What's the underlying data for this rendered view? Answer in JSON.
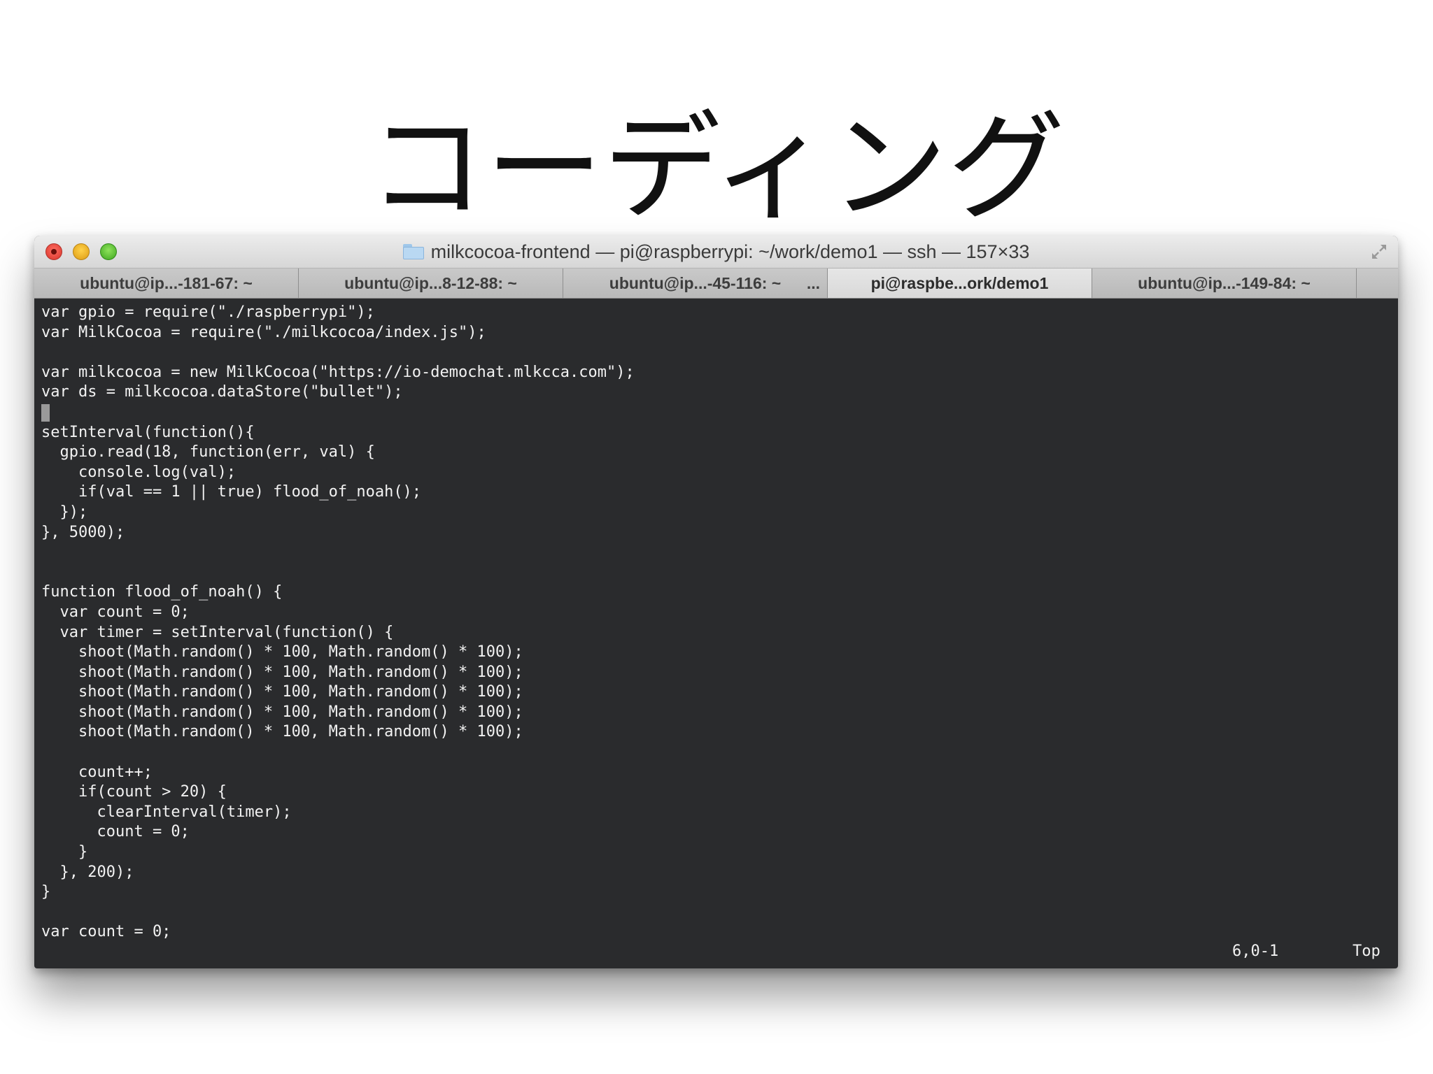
{
  "slide": {
    "title": "コーディング"
  },
  "window": {
    "title": "milkcocoa-frontend — pi@raspberrypi: ~/work/demo1 — ssh — 157×33"
  },
  "tabs": [
    {
      "label": "ubuntu@ip...-181-67: ~",
      "active": false
    },
    {
      "label": "ubuntu@ip...8-12-88: ~",
      "active": false
    },
    {
      "label": "ubuntu@ip...-45-116: ~",
      "active": false
    },
    {
      "label": "pi@raspbe...ork/demo1",
      "active": true
    },
    {
      "label": "ubuntu@ip...-149-84: ~",
      "active": false
    }
  ],
  "tab_overflow": "...",
  "editor": {
    "lines": [
      "var gpio = require(\"./raspberrypi\");",
      "var MilkCocoa = require(\"./milkcocoa/index.js\");",
      "",
      "var milkcocoa = new MilkCocoa(\"https://io-demochat.mlkcca.com\");",
      "var ds = milkcocoa.dataStore(\"bullet\");",
      "",
      "setInterval(function(){",
      "  gpio.read(18, function(err, val) {",
      "    console.log(val);",
      "    if(val == 1 || true) flood_of_noah();",
      "  });",
      "}, 5000);",
      "",
      "",
      "function flood_of_noah() {",
      "  var count = 0;",
      "  var timer = setInterval(function() {",
      "    shoot(Math.random() * 100, Math.random() * 100);",
      "    shoot(Math.random() * 100, Math.random() * 100);",
      "    shoot(Math.random() * 100, Math.random() * 100);",
      "    shoot(Math.random() * 100, Math.random() * 100);",
      "    shoot(Math.random() * 100, Math.random() * 100);",
      "",
      "    count++;",
      "    if(count > 20) {",
      "      clearInterval(timer);",
      "      count = 0;",
      "    }",
      "  }, 200);",
      "}",
      "",
      "var count = 0;"
    ],
    "cursor_line": 6
  },
  "status": {
    "position": "6,0-1",
    "scroll": "Top"
  },
  "colors": {
    "terminal_bg": "#2a2b2d",
    "terminal_fg": "#f2f2f2",
    "close": "#fc5d52",
    "minimize": "#fdbd3e",
    "maximize": "#5bc33c"
  },
  "icons": {
    "close": "close-button-icon",
    "minimize": "minimize-button-icon",
    "maximize": "zoom-button-icon",
    "folder": "folder-icon",
    "fullscreen": "fullscreen-arrows-icon"
  }
}
